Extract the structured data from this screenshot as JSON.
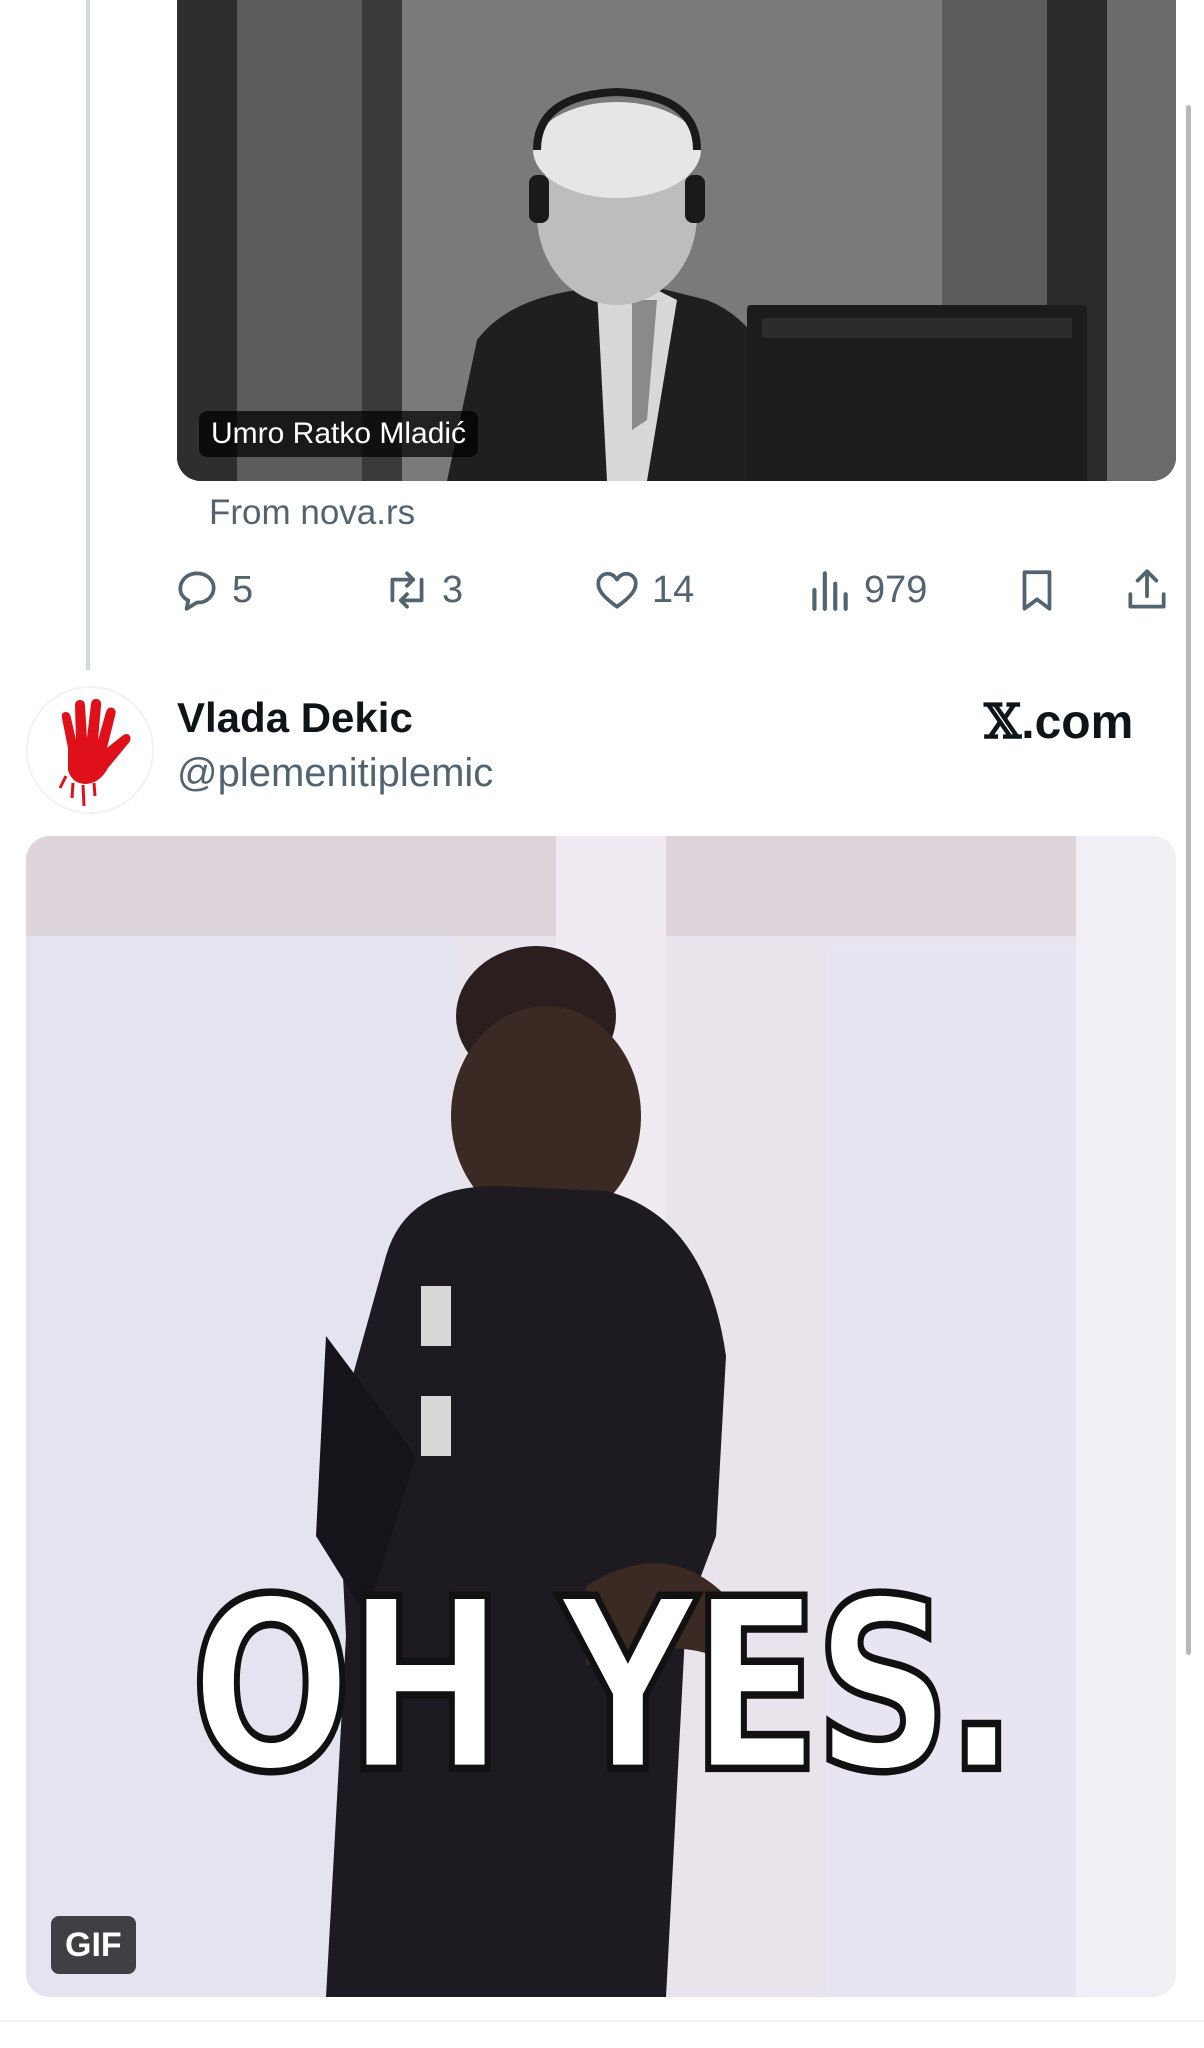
{
  "link_card": {
    "caption": "Umro Ratko Mladić",
    "source": "From nova.rs"
  },
  "actions": {
    "replies": "5",
    "reposts": "3",
    "likes": "14",
    "views": "979"
  },
  "tweet": {
    "author_name": "Vlada Dekic",
    "author_handle": "@plemenitiplemic",
    "brand_x": "𝕏",
    "brand_suffix": ".com",
    "gif_text": "OH YES.",
    "gif_badge": "GIF"
  },
  "colors": {
    "secondary_text": "#536471",
    "primary_text": "#0f1419",
    "avatar_hand": "#e0101a"
  },
  "icons": [
    "reply-icon",
    "repost-icon",
    "like-icon",
    "views-icon",
    "bookmark-icon",
    "share-icon"
  ]
}
